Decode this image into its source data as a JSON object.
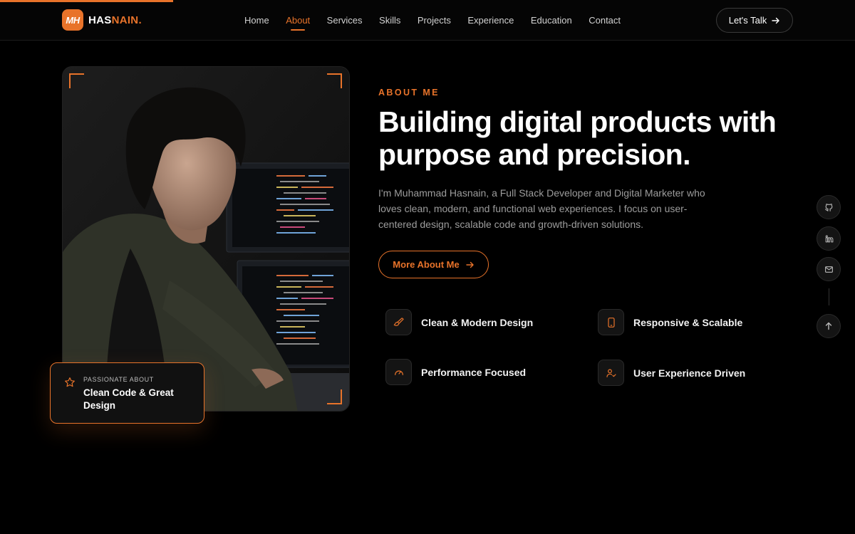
{
  "scroll_progress": 0.2,
  "header": {
    "logo_badge": "MH",
    "logo_name": "HAS",
    "logo_name_accent": "NAIN.",
    "nav": [
      {
        "label": "Home",
        "active": false
      },
      {
        "label": "About",
        "active": true
      },
      {
        "label": "Services",
        "active": false
      },
      {
        "label": "Skills",
        "active": false
      },
      {
        "label": "Projects",
        "active": false
      },
      {
        "label": "Experience",
        "active": false
      },
      {
        "label": "Education",
        "active": false
      },
      {
        "label": "Contact",
        "active": false
      }
    ],
    "cta_label": "Let's Talk"
  },
  "photo": {
    "icon": "portrait-photo-developer",
    "badge_kicker": "PASSIONATE ABOUT",
    "badge_title": "Clean Code & Great Design",
    "badge_icon": "star-icon"
  },
  "about": {
    "kicker": "ABOUT ME",
    "headline": "Building digital products with purpose and precision.",
    "description": "I'm Muhammad Hasnain, a Full Stack Developer and Digital Marketer who loves clean, modern, and functional web experiences. I focus on user-centered design, scalable code and growth-driven solutions.",
    "button_label": "More About Me"
  },
  "features": [
    {
      "label": "Clean & Modern Design",
      "icon": "paintbrush-icon"
    },
    {
      "label": "Responsive & Scalable",
      "icon": "smartphone-icon"
    },
    {
      "label": "Performance Focused",
      "icon": "gauge-icon"
    },
    {
      "label": "User Experience Driven",
      "icon": "user-check-icon"
    }
  ],
  "social": [
    {
      "icon": "github-icon"
    },
    {
      "icon": "linkedin-icon"
    },
    {
      "icon": "mail-icon"
    },
    {
      "icon": "arrow-up-icon"
    }
  ],
  "colors": {
    "accent": "#e8732a",
    "background": "#000000",
    "muted_text": "#9c9c9c"
  }
}
